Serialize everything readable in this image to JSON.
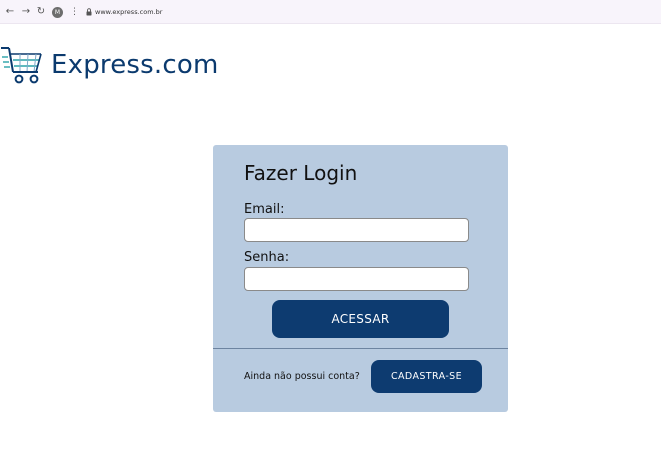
{
  "browser": {
    "back_label": "←",
    "forward_label": "→",
    "reload_label": "↻",
    "avatar_initial": "M",
    "menu_label": "⋮",
    "url": "www.express.com.br"
  },
  "header": {
    "brand_name": "Express.com",
    "logo_icon": "shopping-cart-icon",
    "brand_color": "#0b3a6e"
  },
  "login": {
    "title": "Fazer Login",
    "email_label": "Email:",
    "email_value": "",
    "password_label": "Senha:",
    "password_value": "",
    "submit_label": "ACESSAR",
    "signup_prompt": "Ainda não possui conta?",
    "signup_label": "CADASTRA-SE"
  },
  "colors": {
    "card_background": "#b8cbe0",
    "button_background": "#0d3b70",
    "button_text": "#ffffff"
  }
}
